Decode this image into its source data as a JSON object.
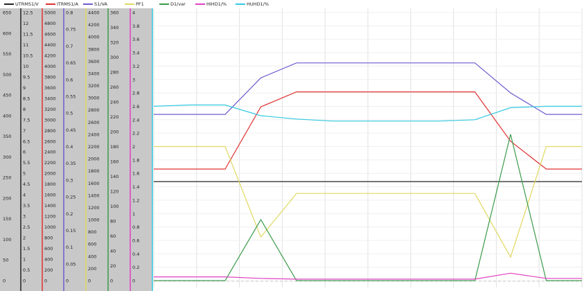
{
  "chart_data": {
    "type": "line",
    "grid": true,
    "x": [
      0,
      1,
      2,
      3,
      4,
      5,
      6,
      7,
      8,
      9,
      10,
      11,
      12
    ],
    "series": [
      {
        "name": "UTRMS1/V",
        "color": "#222222",
        "axis": 0,
        "values": [
          240,
          240,
          240,
          240,
          240,
          240,
          240,
          240,
          240,
          240,
          240,
          240,
          240
        ]
      },
      {
        "name": "ITRMS1/A",
        "color": "#e03030",
        "axis": 1,
        "values": [
          5.2,
          5.2,
          5.2,
          8.1,
          8.8,
          8.8,
          8.8,
          8.8,
          8.8,
          8.8,
          6.5,
          5.2,
          5.2
        ]
      },
      {
        "name": "S1/VA",
        "color": "#6a5acd",
        "axis": 2,
        "values": [
          3100,
          3100,
          3100,
          3780,
          4060,
          4060,
          4060,
          4060,
          4060,
          4060,
          3500,
          3100,
          3100
        ]
      },
      {
        "name": "PF1",
        "color": "#e0d860",
        "axis": 3,
        "values": [
          0.4,
          0.4,
          0.4,
          0.13,
          0.26,
          0.26,
          0.26,
          0.26,
          0.26,
          0.26,
          0.07,
          0.4,
          0.4
        ]
      },
      {
        "name": "D1/var",
        "color": "#3a9a4a",
        "axis": 4,
        "values": [
          0,
          0,
          0,
          1000,
          0,
          0,
          0,
          0,
          0,
          0,
          2400,
          0,
          0
        ]
      },
      {
        "name": "HIHD1/%",
        "color": "#e040c0",
        "axis": 5,
        "values": [
          5,
          5,
          5,
          3,
          2,
          2,
          2,
          2,
          2,
          2,
          10,
          3,
          3
        ]
      },
      {
        "name": "HUHD1/%",
        "color": "#30c8e0",
        "axis": 6,
        "values": [
          2.6,
          2.62,
          2.62,
          2.46,
          2.41,
          2.38,
          2.38,
          2.38,
          2.38,
          2.4,
          2.58,
          2.6,
          2.6
        ]
      }
    ],
    "axes": [
      {
        "series": "UTRMS1/V",
        "color": "#222222",
        "min": 0,
        "max": 650,
        "ticks": [
          "0",
          "50",
          "100",
          "150",
          "200",
          "250",
          "300",
          "350",
          "400",
          "450",
          "500",
          "550",
          "600",
          "650"
        ],
        "tick_values": [
          0,
          50,
          100,
          150,
          200,
          250,
          300,
          350,
          400,
          450,
          500,
          550,
          600,
          650
        ]
      },
      {
        "series": "ITRMS1/A",
        "color": "#e03030",
        "min": 0,
        "max": 12.5,
        "ticks": [
          "0",
          "0.5",
          "1",
          "1.5",
          "2",
          "2.5",
          "3",
          "3.5",
          "4",
          "4.5",
          "5",
          "5.5",
          "6",
          "6.5",
          "7",
          "7.5",
          "8",
          "8.5",
          "9",
          "9.5",
          "10",
          "10.5",
          "11",
          "11.5",
          "12",
          "12.5"
        ],
        "tick_values": [
          0,
          0.5,
          1,
          1.5,
          2,
          2.5,
          3,
          3.5,
          4,
          4.5,
          5,
          5.5,
          6,
          6.5,
          7,
          7.5,
          8,
          8.5,
          9,
          9.5,
          10,
          10.5,
          11,
          11.5,
          12,
          12.5
        ]
      },
      {
        "series": "S1/VA",
        "color": "#6a5acd",
        "min": 0,
        "max": 5000,
        "ticks": [
          "0",
          "200",
          "400",
          "600",
          "800",
          "1000",
          "1200",
          "1400",
          "1600",
          "1800",
          "2000",
          "2200",
          "2400",
          "2600",
          "2800",
          "3000",
          "3200",
          "3400",
          "3600",
          "3800",
          "4000",
          "4200",
          "4400",
          "4600",
          "4800",
          "5000"
        ],
        "tick_values": [
          0,
          200,
          400,
          600,
          800,
          1000,
          1200,
          1400,
          1600,
          1800,
          2000,
          2200,
          2400,
          2600,
          2800,
          3000,
          3200,
          3400,
          3600,
          3800,
          4000,
          4200,
          4400,
          4600,
          4800,
          5000
        ]
      },
      {
        "series": "PF1",
        "color": "#e0d860",
        "min": 0,
        "max": 0.8,
        "ticks": [
          "0",
          "0.05",
          "0.1",
          "0.15",
          "0.2",
          "0.25",
          "0.3",
          "0.35",
          "0.4",
          "0.45",
          "0.5",
          "0.55",
          "0.6",
          "0.65",
          "0.7",
          "0.75",
          "0.8"
        ],
        "tick_values": [
          0,
          0.05,
          0.1,
          0.15,
          0.2,
          0.25,
          0.3,
          0.35,
          0.4,
          0.45,
          0.5,
          0.55,
          0.6,
          0.65,
          0.7,
          0.75,
          0.8
        ]
      },
      {
        "series": "D1/var",
        "color": "#3a9a4a",
        "min": 0,
        "max": 4400,
        "ticks": [
          "0",
          "200",
          "400",
          "600",
          "800",
          "1000",
          "1200",
          "1400",
          "1600",
          "1800",
          "2000",
          "2200",
          "2400",
          "2600",
          "2800",
          "3000",
          "3200",
          "3400",
          "3600",
          "3800",
          "4000",
          "4200",
          "4400"
        ],
        "tick_values": [
          0,
          200,
          400,
          600,
          800,
          1000,
          1200,
          1400,
          1600,
          1800,
          2000,
          2200,
          2400,
          2600,
          2800,
          3000,
          3200,
          3400,
          3600,
          3800,
          4000,
          4200,
          4400
        ]
      },
      {
        "series": "HIHD1/%",
        "color": "#e040c0",
        "min": 0,
        "max": 360,
        "ticks": [
          "0",
          "20",
          "40",
          "60",
          "80",
          "100",
          "120",
          "140",
          "160",
          "180",
          "200",
          "220",
          "240",
          "260",
          "280",
          "300",
          "320",
          "340",
          "360"
        ],
        "tick_values": [
          0,
          20,
          40,
          60,
          80,
          100,
          120,
          140,
          160,
          180,
          200,
          220,
          240,
          260,
          280,
          300,
          320,
          340,
          360
        ]
      },
      {
        "series": "HUHD1/%",
        "color": "#30c8e0",
        "min": 0,
        "max": 4,
        "ticks": [
          "0",
          "0.2",
          "0.4",
          "0.6",
          "0.8",
          "1",
          "1.2",
          "1.4",
          "1.6",
          "1.8",
          "2",
          "2.2",
          "2.4",
          "2.6",
          "2.8",
          "3",
          "3.2",
          "3.4",
          "3.6",
          "3.8",
          "4"
        ],
        "tick_values": [
          0,
          0.2,
          0.4,
          0.6,
          0.8,
          1,
          1.2,
          1.4,
          1.6,
          1.8,
          2,
          2.2,
          2.4,
          2.6,
          2.8,
          3,
          3.2,
          3.4,
          3.6,
          3.8,
          4
        ]
      }
    ]
  }
}
